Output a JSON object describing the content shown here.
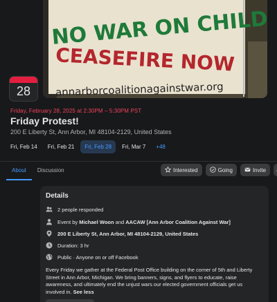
{
  "cover": {
    "line1": "NO WAR ON CHILDREN",
    "line2": "CEASEFIRE NOW",
    "line3": "annarborcoalitionagainstwar.org"
  },
  "badge": {
    "day": "28"
  },
  "event": {
    "when": "Friday, February 28, 2025 at 2:30PM – 5:30PM PST",
    "title": "Friday Protest!",
    "address": "200 E Liberty St, Ann Arbor, MI 48104-2129, United States"
  },
  "dates": [
    {
      "label": "Fri, Feb 14"
    },
    {
      "label": "Fri, Feb 21"
    },
    {
      "label": "Fri, Feb 28"
    },
    {
      "label": "Fri, Mar 7"
    },
    {
      "label": "+48"
    }
  ],
  "tabs": {
    "about": "About",
    "discussion": "Discussion"
  },
  "actions": {
    "interested": "Interested",
    "going": "Going",
    "invite": "Invite"
  },
  "details": {
    "heading": "Details",
    "responded": "2 people responded",
    "host_prefix": "Event by ",
    "host_1": "Michael Woon",
    "host_and": " and ",
    "host_2": "AACAW [Ann Arbor Coalition Against War]",
    "location": "200 E Liberty St, Ann Arbor, MI 48104-2129, United States",
    "duration": "Duration: 3 hr",
    "privacy": "Public · Anyone on or off Facebook",
    "description": "Every Friday we gather at the Federal Post Office building on the corner of 5th and Liberty Street in Ann Arbor, Michigan. We bring banners, signs, and flyers to educate, raise awareness, and ultimately end the unjust wars our elected government officials get us involved in. ",
    "see_less": "See less"
  },
  "colors": {
    "accent": "#4599ff",
    "date_red": "#f3425f",
    "badge_red": "#e41e3f",
    "background": "#18191a",
    "card": "#242526"
  }
}
